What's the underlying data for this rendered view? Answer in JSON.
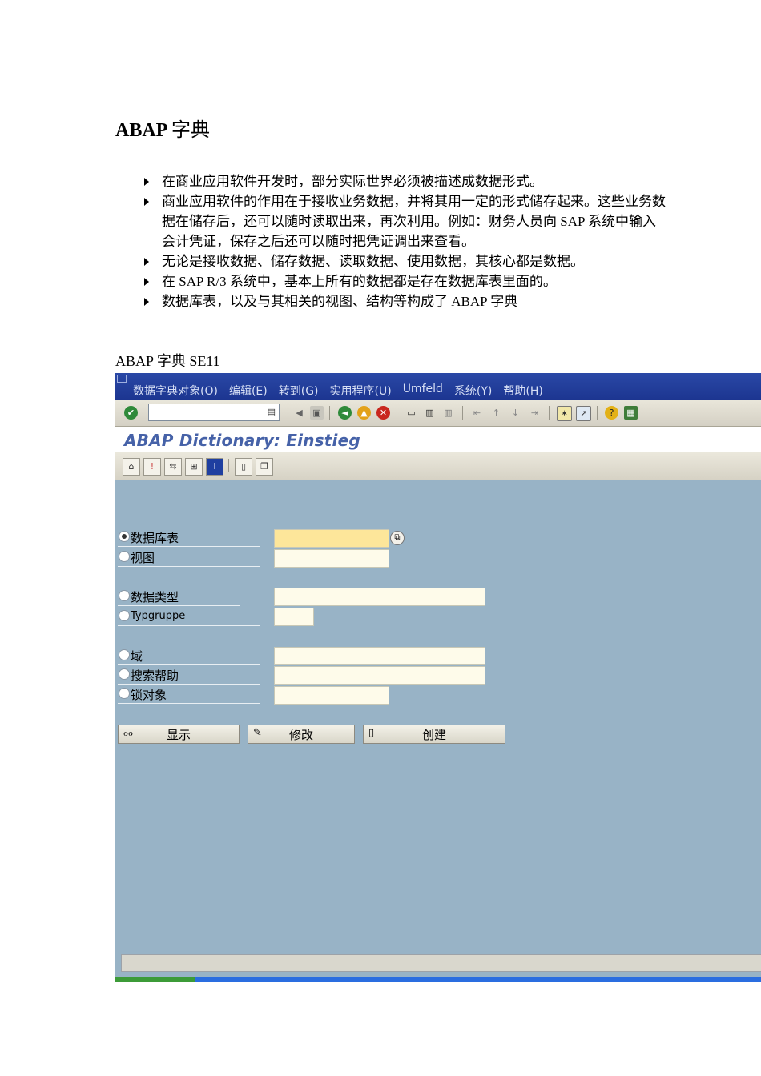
{
  "doc": {
    "title_latin": "ABAP",
    "title_cjk": "字典",
    "bullets": [
      "在商业应用软件开发时，部分实际世界必须被描述成数据形式。",
      "商业应用软件的作用在于接收业务数据，并将其用一定的形式储存起来。这些业务数据在储存后，还可以随时读取出来，再次利用。例如：财务人员向 SAP 系统中输入会计凭证，保存之后还可以随时把凭证调出来查看。",
      "无论是接收数据、储存数据、读取数据、使用数据，其核心都是数据。",
      "在 SAP R/3 系统中，基本上所有的数据都是存在数据库表里面的。",
      "数据库表，以及与其相关的视图、结构等构成了 ABAP 字典"
    ],
    "caption": "ABAP 字典 SE11"
  },
  "sap": {
    "menu": [
      "数据字典对象(O)",
      "编辑(E)",
      "转到(G)",
      "实用程序(U)",
      "Umfeld",
      "系统(Y)",
      "帮助(H)"
    ],
    "title": "ABAP Dictionary: Einstieg",
    "options": [
      {
        "label": "数据库表",
        "selected": true
      },
      {
        "label": "视图",
        "selected": false
      },
      {
        "label": "数据类型",
        "selected": false
      },
      {
        "label": "Typgruppe",
        "selected": false
      },
      {
        "label": "域",
        "selected": false
      },
      {
        "label": "搜索帮助",
        "selected": false
      },
      {
        "label": "锁对象",
        "selected": false
      }
    ],
    "buttons": {
      "display": "显示",
      "change": "修改",
      "create": "创建"
    },
    "icons": {
      "enter": "check-icon",
      "command_field": "list-icon",
      "back": "back-icon",
      "exit": "exit-icon",
      "cancel": "cancel-icon",
      "print": "print-icon",
      "find": "find-icon",
      "help": "help-icon",
      "value_help": "value-help-icon"
    }
  }
}
